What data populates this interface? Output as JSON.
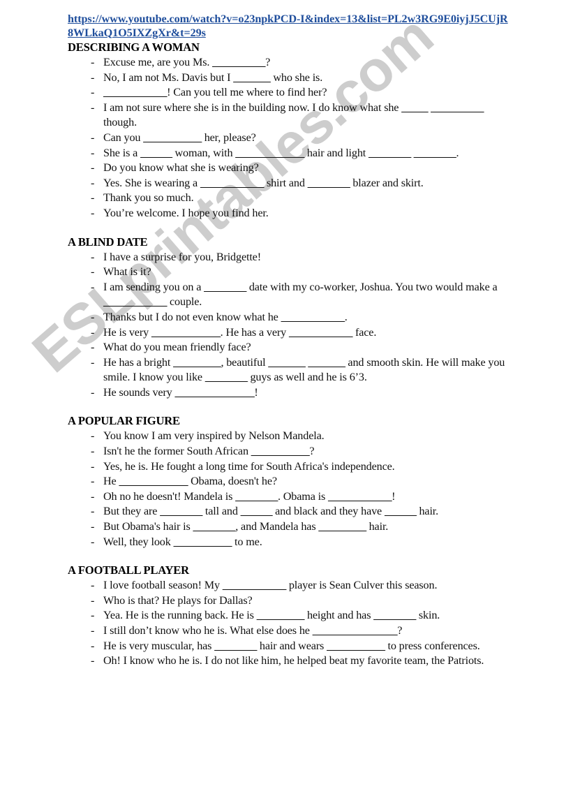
{
  "document": {
    "header_link": "https://www.youtube.com/watch?v=o23npkPCD-I&index=13&list=PL2w3RG9E0iyjJ5CUjR8WLkaQ1O5IXZgXr&t=29s",
    "watermark": "ESLprintables.com",
    "bullet": "-",
    "link_color": "#1f4e9c",
    "watermark_color": "#c9c9c9",
    "text_color": "#111111",
    "sections": [
      {
        "title": "DESCRIBING A WOMAN",
        "lines": [
          "Excuse me, are you Ms. __________?",
          "No, I am not Ms. Davis but I _______ who she is.",
          "____________! Can you tell me where to find her?",
          "I am not sure where she is in the building now. I do know what she _____ __________ though.",
          "Can you ___________ her, please?",
          "She is a ______ woman, with _____________ hair and light ________ ________.",
          "Do you know what she is wearing?",
          "Yes. She is wearing a ____________ shirt and ________ blazer and skirt.",
          "Thank you so much.",
          "You’re welcome. I hope you find her."
        ]
      },
      {
        "title": "A BLIND DATE",
        "lines": [
          "I have a surprise for you, Bridgette!",
          "What is it?",
          "I am sending you on a ________ date with my co-worker, Joshua. You two would make a ____________ couple.",
          "Thanks but I do not even know what he ____________.",
          "He is very _____________. He has a very ____________ face.",
          "What do you mean friendly face?",
          "He has a bright _________, beautiful _______ _______ and smooth skin. He will make you smile. I know you like ________ guys as well and he is 6’3.",
          "He sounds very _______________!"
        ]
      },
      {
        "title": "A POPULAR FIGURE",
        "lines": [
          "You know I am very inspired by Nelson Mandela.",
          "Isn't he the former South African ___________?",
          "Yes, he is. He fought a long time for South Africa's independence.",
          "He _____________ Obama, doesn't he?",
          "Oh no he doesn't! Mandela is ________. Obama is ____________!",
          "But they are ________ tall and ______ and black and they have ______ hair.",
          "But Obama's hair is ________, and Mandela has _________ hair.",
          "Well, they look ___________ to me."
        ]
      },
      {
        "title": "A FOOTBALL PLAYER",
        "lines": [
          "I love football season! My ____________ player is Sean Culver this season.",
          "Who is that? He plays for Dallas?",
          "Yea. He is the running back. He is _________ height and has ________ skin.",
          "I still don’t know who he is.  What else does he ________________?",
          "He is very muscular, has ________ hair and wears ___________ to press conferences.",
          "Oh! I know who he is. I do not like him, he helped beat my favorite team, the Patriots."
        ]
      }
    ]
  }
}
